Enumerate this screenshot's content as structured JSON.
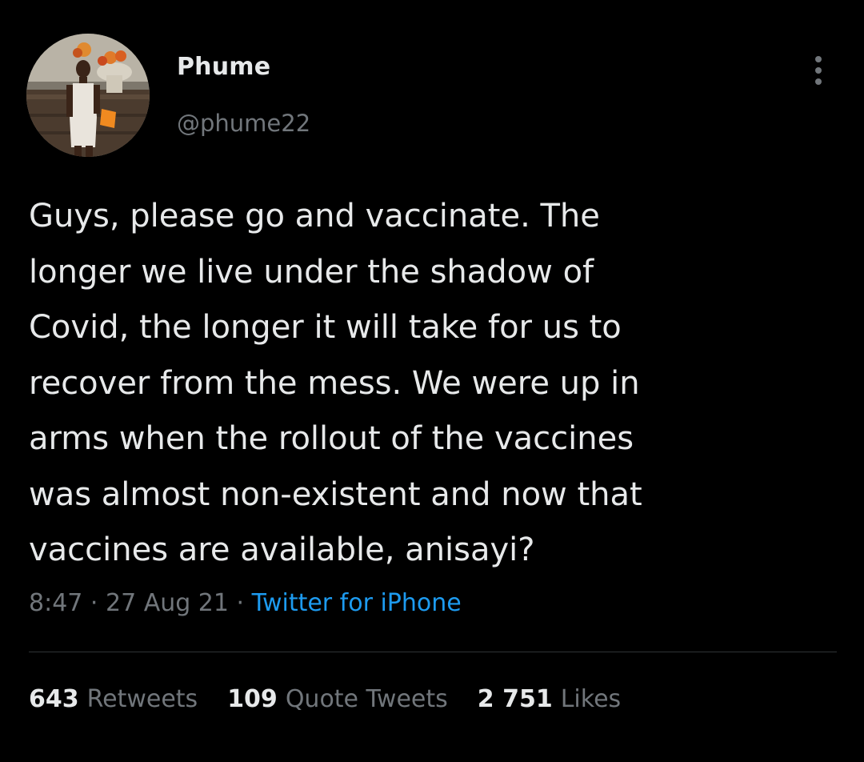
{
  "user": {
    "display_name": "Phume",
    "handle": "@phume22",
    "avatar_icon": "profile-photo"
  },
  "tweet": {
    "text": "Guys, please go and vaccinate. The\nlonger we live under the shadow of\nCovid, the longer it will take for us to\nrecover from the mess. We were up in\narms when the rollout of the vaccines\nwas almost non-existent and now that\nvaccines are available, anisayi?",
    "time": "8:47",
    "sep1": " · ",
    "date": "27 Aug 21",
    "sep2": " · ",
    "source": "Twitter for iPhone"
  },
  "stats": {
    "retweets_count": "643",
    "retweets_label": "Retweets",
    "quotes_count": "109",
    "quotes_label": "Quote Tweets",
    "likes_count": "2 751",
    "likes_label": "Likes"
  },
  "colors": {
    "background": "#000000",
    "primary_text": "#e7e9ea",
    "secondary_text": "#71767b",
    "link": "#1d9bf0",
    "divider": "#2f3336"
  },
  "icons": {
    "more": "more-vertical-icon"
  }
}
